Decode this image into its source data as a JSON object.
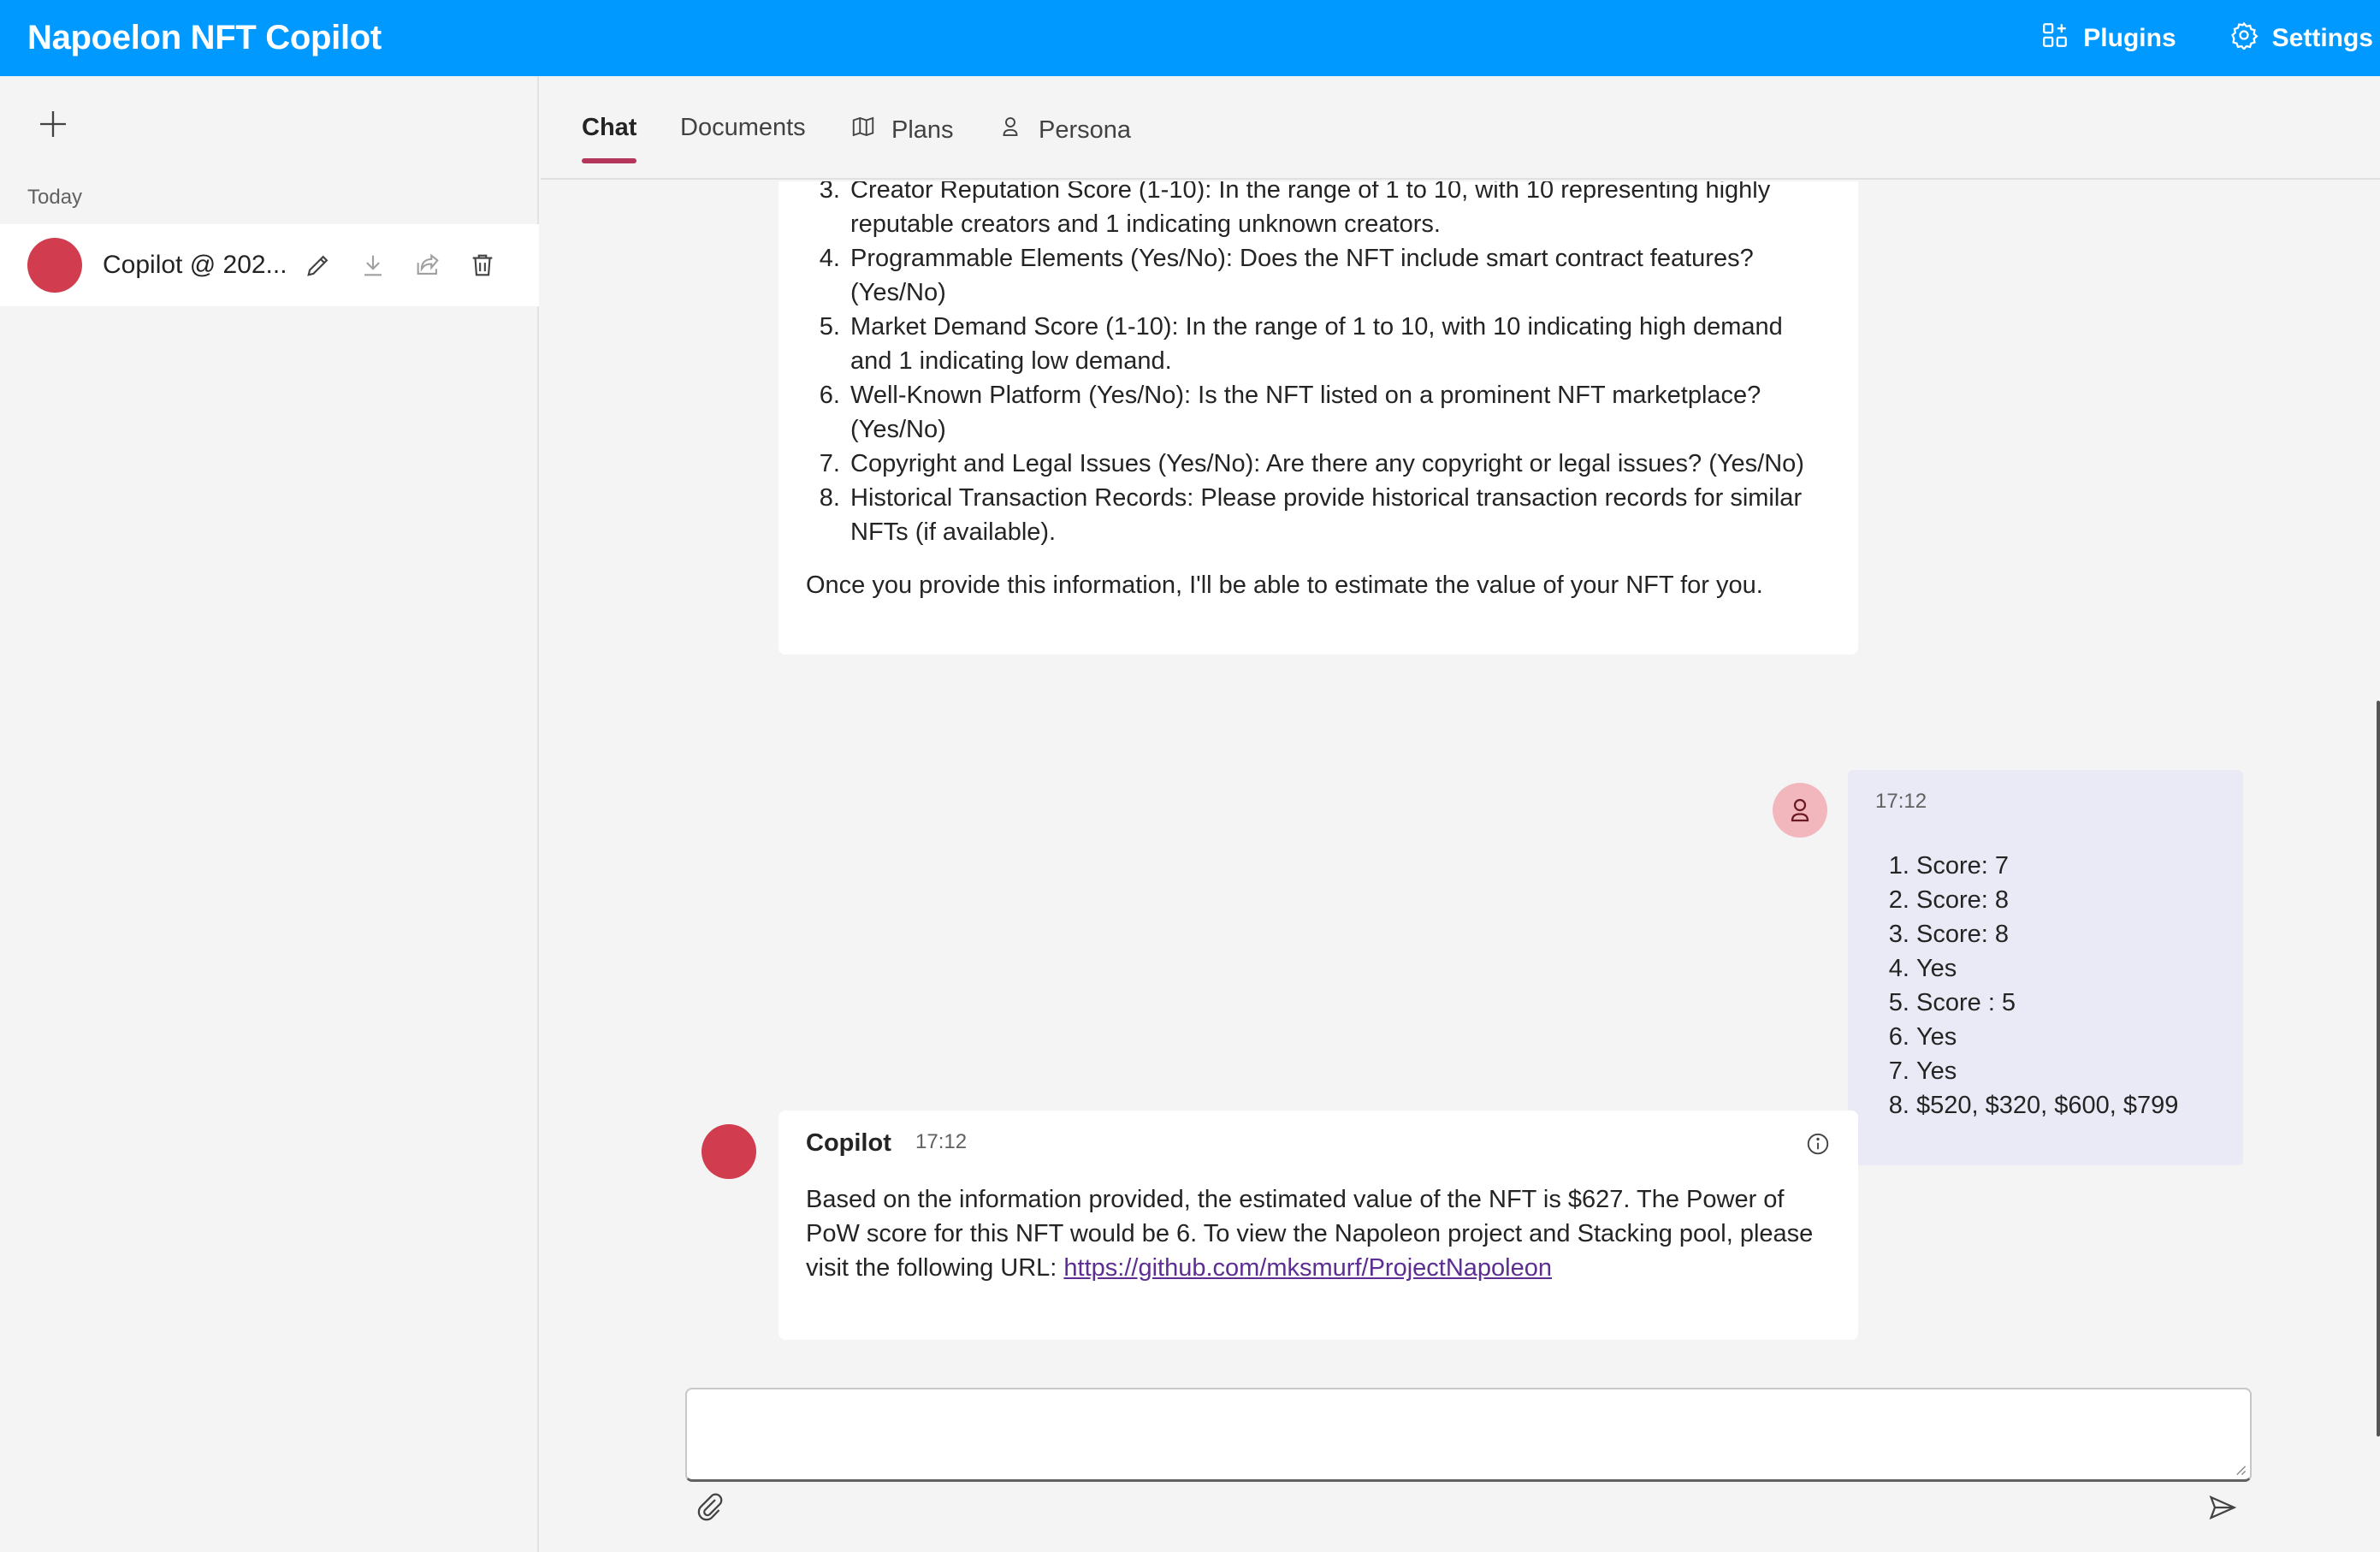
{
  "header": {
    "title": "Napoelon NFT Copilot",
    "plugins_label": "Plugins",
    "settings_label": "Settings",
    "bg_color": "#0099ff"
  },
  "sidebar": {
    "section_label": "Today",
    "chats": [
      {
        "label": "Copilot @ 202...",
        "avatar_color": "#d13d4e"
      }
    ]
  },
  "tabs": [
    {
      "label": "Chat",
      "active": true
    },
    {
      "label": "Documents",
      "active": false
    },
    {
      "label": "Plans",
      "active": false,
      "icon": "map-icon"
    },
    {
      "label": "Persona",
      "active": false,
      "icon": "person-icon"
    }
  ],
  "messages": {
    "bot_prev": {
      "items": [
        "Creator Reputation Score (1-10): In the range of 1 to 10, with 10 representing highly reputable creators and 1 indicating unknown creators.",
        "Programmable Elements (Yes/No): Does the NFT include smart contract features? (Yes/No)",
        "Market Demand Score (1-10): In the range of 1 to 10, with 10 indicating high demand and 1 indicating low demand.",
        "Well-Known Platform (Yes/No): Is the NFT listed on a prominent NFT marketplace? (Yes/No)",
        "Copyright and Legal Issues (Yes/No): Are there any copyright or legal issues? (Yes/No)",
        "Historical Transaction Records: Please provide historical transaction records for similar NFTs (if available)."
      ],
      "closing": "Once you provide this information, I'll be able to estimate the value of your NFT for you."
    },
    "user": {
      "time": "17:12",
      "items": [
        "Score: 7",
        "Score: 8",
        "Score: 8",
        "Yes",
        "Score : 5",
        "Yes",
        "Yes",
        "$520, $320, $600, $799"
      ]
    },
    "bot": {
      "sender": "Copilot",
      "time": "17:12",
      "text": "Based on the information provided, the estimated value of the NFT is $627. The Power of PoW score for this NFT would be 6. To view the Napoleon project and Stacking pool, please visit the following URL: ",
      "link": "https://github.com/mksmurf/ProjectNapoleon"
    }
  },
  "composer": {
    "placeholder": ""
  }
}
